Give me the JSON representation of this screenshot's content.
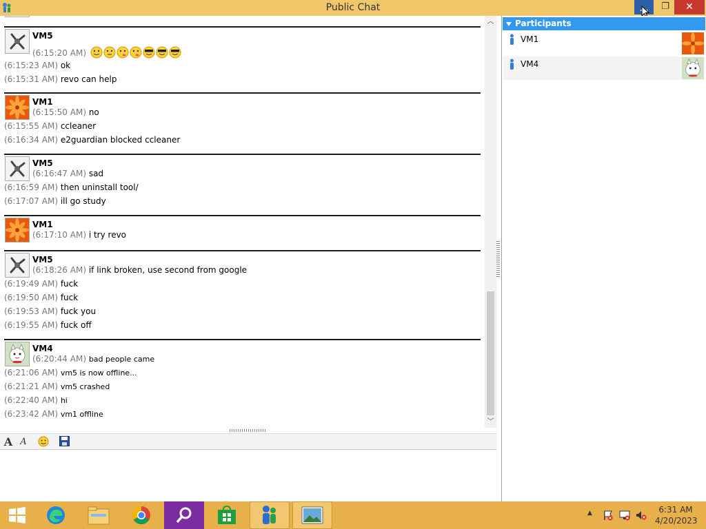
{
  "window": {
    "title": "Public Chat",
    "min_icon": "minimize-icon",
    "max_icon": "restore-icon",
    "close_icon": "close-icon"
  },
  "groups": [
    {
      "sender": "VM5",
      "avatar": "vm5-avatar",
      "lines": [
        {
          "ts": "(6:15:20 AM)",
          "text": ""
        },
        {
          "ts": "(6:15:23 AM)",
          "text": "ok"
        },
        {
          "ts": "(6:15:31 AM)",
          "text": "revo can help"
        }
      ]
    },
    {
      "sender": "VM1",
      "avatar": "vm1-avatar",
      "lines": [
        {
          "ts": "(6:15:50 AM)",
          "text": "no"
        },
        {
          "ts": "(6:15:55 AM)",
          "text": "ccleaner"
        },
        {
          "ts": "(6:16:34 AM)",
          "text": "e2guardian blocked ccleaner"
        }
      ]
    },
    {
      "sender": "VM5",
      "avatar": "vm5-avatar",
      "lines": [
        {
          "ts": "(6:16:47 AM)",
          "text": "sad"
        },
        {
          "ts": "(6:16:59 AM)",
          "text": "then uninstall tool/"
        },
        {
          "ts": "(6:17:07 AM)",
          "text": "ill go study"
        }
      ]
    },
    {
      "sender": "VM1",
      "avatar": "vm1-avatar",
      "lines": [
        {
          "ts": "(6:17:10 AM)",
          "text": "i try revo"
        }
      ]
    },
    {
      "sender": "VM5",
      "avatar": "vm5-avatar",
      "lines": [
        {
          "ts": "(6:18:26 AM)",
          "text": "if link broken, use second from google"
        },
        {
          "ts": "(6:19:49 AM)",
          "text": "fuck"
        },
        {
          "ts": "(6:19:50 AM)",
          "text": "fuck"
        },
        {
          "ts": "(6:19:53 AM)",
          "text": "fuck you"
        },
        {
          "ts": "(6:19:55 AM)",
          "text": "fuck off"
        }
      ]
    },
    {
      "sender": "VM4",
      "avatar": "vm4-avatar",
      "lines": [
        {
          "ts": "(6:20:44 AM)",
          "text": "bad people came"
        },
        {
          "ts": "(6:21:06 AM)",
          "text": "vm5 is now offline..."
        },
        {
          "ts": "(6:21:21 AM)",
          "text": "vm5 crashed"
        },
        {
          "ts": "(6:22:40 AM)",
          "text": "hi"
        },
        {
          "ts": "(6:23:42 AM)",
          "text": "vm1 offline"
        }
      ]
    }
  ],
  "toolbar": {
    "font_icon": "font-icon",
    "font_style_icon": "font-style-icon",
    "smiley_icon": "smiley-icon",
    "save_icon": "save-icon"
  },
  "participants": {
    "header": "Participants",
    "items": [
      {
        "name": "VM1"
      },
      {
        "name": "VM4"
      }
    ]
  },
  "taskbar": {
    "apps": [
      "start-icon",
      "edge-icon",
      "file-explorer-icon",
      "chrome-icon",
      "search-app-icon",
      "store-icon",
      "messenger-icon",
      "photos-icon"
    ],
    "time": "6:31 AM",
    "date": "4/20/2023"
  },
  "colors": {
    "titlebar": "#f0c86a",
    "taskbar": "#e8b04a",
    "participants_header": "#3399ee",
    "timestamp": "#777777"
  }
}
